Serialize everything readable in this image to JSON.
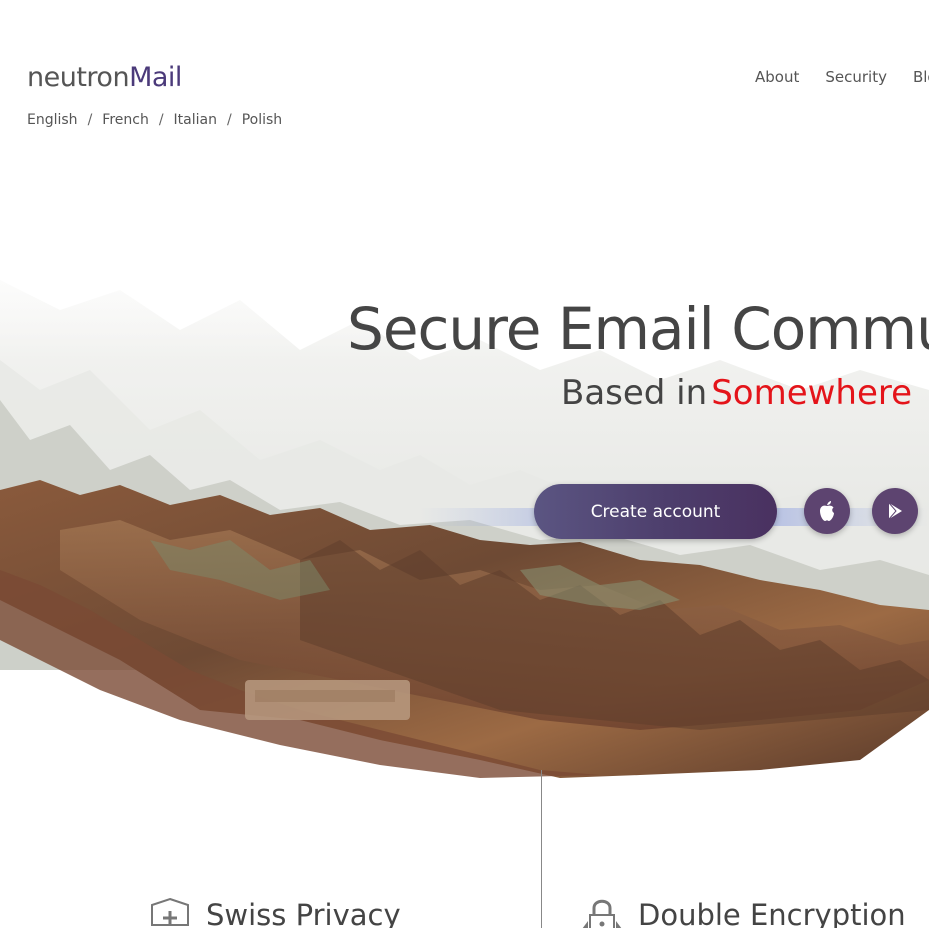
{
  "brand": {
    "name_part1": "neutron",
    "name_part2": "Mail"
  },
  "languages": [
    "English",
    "French",
    "Italian",
    "Polish"
  ],
  "language_separator": "/",
  "nav": {
    "items": [
      "About",
      "Security",
      "Blog"
    ]
  },
  "hero": {
    "headline": "Secure Email Commun",
    "subline_prefix": "Based in",
    "subline_accent": "Somewhere",
    "cta_label": "Create account",
    "apple_icon": "apple-icon",
    "play_icon": "play-store-icon"
  },
  "features": [
    {
      "icon": "shield-plus-icon",
      "title": "Swiss Privacy"
    },
    {
      "icon": "padlock-icon",
      "title": "Double Encryption"
    }
  ],
  "colors": {
    "brand_purple": "#4b3a7a",
    "accent_red": "#e4141a",
    "button_purple": "#5d4470",
    "text_gray": "#555555"
  }
}
